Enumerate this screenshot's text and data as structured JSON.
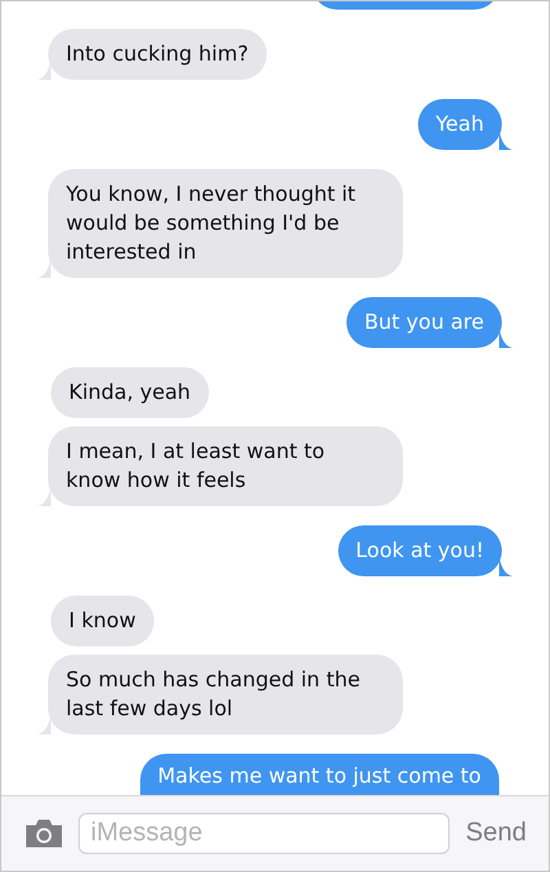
{
  "messages": [
    {
      "kind": "sent",
      "partial": true
    },
    {
      "kind": "received",
      "text": "Into cucking him?"
    },
    {
      "kind": "sent",
      "text": "Yeah"
    },
    {
      "kind": "received",
      "text": "You know, I never thought it would be something I'd be interested in"
    },
    {
      "kind": "sent",
      "text": "But you are"
    },
    {
      "kind": "received",
      "text": "Kinda, yeah"
    },
    {
      "kind": "received",
      "text": "I mean, I at least want to know how it feels"
    },
    {
      "kind": "sent",
      "text": "Look at you!"
    },
    {
      "kind": "received",
      "text": "I know"
    },
    {
      "kind": "received",
      "text": "So much has changed in the last few days lol"
    },
    {
      "kind": "sent",
      "text": "Makes me want to just come to",
      "partial": true
    }
  ],
  "composer": {
    "placeholder": "iMessage",
    "send": "Send"
  }
}
